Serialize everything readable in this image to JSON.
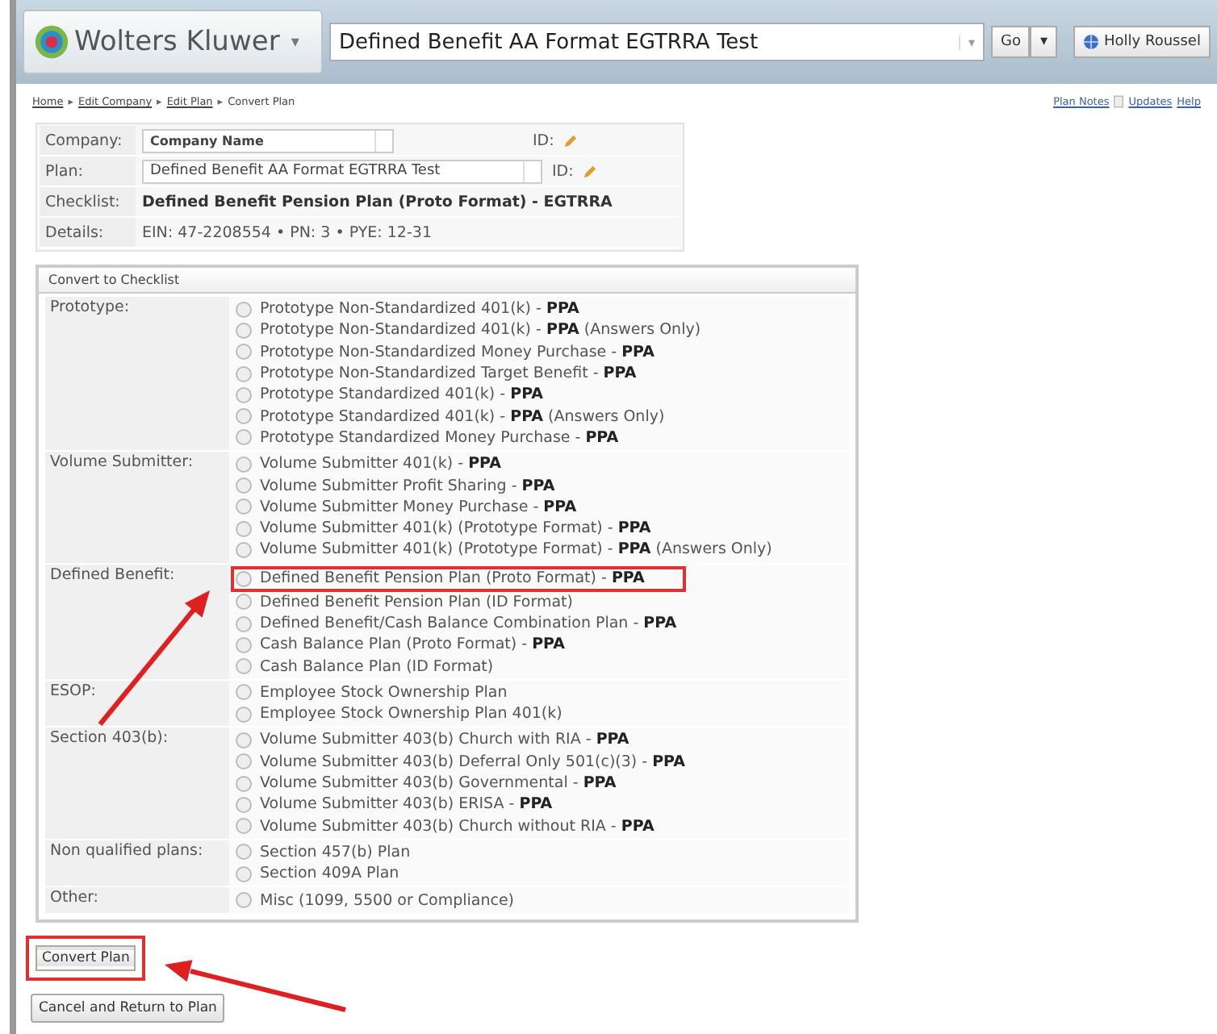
{
  "header": {
    "brand": "Wolters Kluwer",
    "brand_caret": "▾",
    "plan_search": {
      "value": "Defined Benefit AA Format EGTRRA Test",
      "caret": "▾"
    },
    "go_button": "Go",
    "go_caret": "▾",
    "user": "Holly Roussel"
  },
  "breadcrumb": [
    {
      "label": "Home",
      "link": true
    },
    {
      "label": "Edit Company",
      "link": true
    },
    {
      "label": "Edit Plan",
      "link": true
    },
    {
      "label": "Convert Plan",
      "link": false
    }
  ],
  "breadcrumb_separator": "▸",
  "top_links": [
    "Plan Notes",
    "Updates",
    "Help"
  ],
  "info": {
    "company": {
      "label": "Company:",
      "value": "Company Name",
      "id_label": "ID:"
    },
    "plan": {
      "label": "Plan:",
      "value": "Defined Benefit AA Format EGTRRA Test",
      "id_label": "ID:"
    },
    "checklist": {
      "label": "Checklist:",
      "value": "Defined Benefit Pension Plan (Proto Format) - EGTRRA"
    },
    "details": {
      "label": "Details:",
      "value": "EIN: 47-2208554 • PN: 3 • PYE: 12-31"
    }
  },
  "panel": {
    "title": "Convert to Checklist",
    "groups": [
      {
        "label": "Prototype:",
        "options": [
          {
            "text": "Prototype Non-Standardized 401(k) - **PPA**",
            "selected": false,
            "highlighted": false
          },
          {
            "text": "Prototype Non-Standardized 401(k) - **PPA** (Answers Only)",
            "selected": false,
            "highlighted": false
          },
          {
            "text": "Prototype Non-Standardized Money Purchase - **PPA**",
            "selected": false,
            "highlighted": false
          },
          {
            "text": "Prototype Non-Standardized Target Benefit - **PPA**",
            "selected": false,
            "highlighted": false
          },
          {
            "text": "Prototype Standardized 401(k) - **PPA**",
            "selected": false,
            "highlighted": false
          },
          {
            "text": "Prototype Standardized 401(k) - **PPA** (Answers Only)",
            "selected": false,
            "highlighted": false
          },
          {
            "text": "Prototype Standardized Money Purchase - **PPA**",
            "selected": false,
            "highlighted": false
          }
        ]
      },
      {
        "label": "Volume Submitter:",
        "options": [
          {
            "text": "Volume Submitter 401(k) - **PPA**",
            "selected": false,
            "highlighted": false
          },
          {
            "text": "Volume Submitter Profit Sharing - **PPA**",
            "selected": false,
            "highlighted": false
          },
          {
            "text": "Volume Submitter Money Purchase - **PPA**",
            "selected": false,
            "highlighted": false
          },
          {
            "text": "Volume Submitter 401(k) (Prototype Format) - **PPA**",
            "selected": false,
            "highlighted": false
          },
          {
            "text": "Volume Submitter 401(k) (Prototype Format) - **PPA** (Answers Only)",
            "selected": false,
            "highlighted": false
          }
        ]
      },
      {
        "label": "Defined Benefit:",
        "options": [
          {
            "text": "Defined Benefit Pension Plan (Proto Format) - **PPA**",
            "selected": false,
            "highlighted": true
          },
          {
            "text": "Defined Benefit Pension Plan (ID Format)",
            "selected": false,
            "highlighted": false
          },
          {
            "text": "Defined Benefit/Cash Balance Combination Plan - **PPA**",
            "selected": false,
            "highlighted": false
          },
          {
            "text": "Cash Balance Plan (Proto Format) - **PPA**",
            "selected": false,
            "highlighted": false
          },
          {
            "text": "Cash Balance Plan (ID Format)",
            "selected": false,
            "highlighted": false
          }
        ]
      },
      {
        "label": "ESOP:",
        "options": [
          {
            "text": "Employee Stock Ownership Plan",
            "selected": false,
            "highlighted": false
          },
          {
            "text": "Employee Stock Ownership Plan 401(k)",
            "selected": false,
            "highlighted": false
          }
        ]
      },
      {
        "label": "Section 403(b):",
        "options": [
          {
            "text": "Volume Submitter 403(b) Church with RIA - **PPA**",
            "selected": false,
            "highlighted": false
          },
          {
            "text": "Volume Submitter 403(b) Deferral Only 501(c)(3) - **PPA**",
            "selected": false,
            "highlighted": false
          },
          {
            "text": "Volume Submitter 403(b) Governmental - **PPA**",
            "selected": false,
            "highlighted": false
          },
          {
            "text": "Volume Submitter 403(b) ERISA - **PPA**",
            "selected": false,
            "highlighted": false
          },
          {
            "text": "Volume Submitter 403(b) Church without RIA - **PPA**",
            "selected": false,
            "highlighted": false
          }
        ]
      },
      {
        "label": "Non qualified plans:",
        "options": [
          {
            "text": "Section 457(b) Plan",
            "selected": false,
            "highlighted": false
          },
          {
            "text": "Section 409A Plan",
            "selected": false,
            "highlighted": false
          }
        ]
      },
      {
        "label": "Other:",
        "options": [
          {
            "text": "Misc (1099, 5500 or Compliance)",
            "selected": false,
            "highlighted": false
          }
        ]
      }
    ]
  },
  "buttons": [
    {
      "label": "Convert Plan",
      "highlighted": true
    },
    {
      "label": "Cancel and Return to Plan",
      "highlighted": false
    }
  ]
}
